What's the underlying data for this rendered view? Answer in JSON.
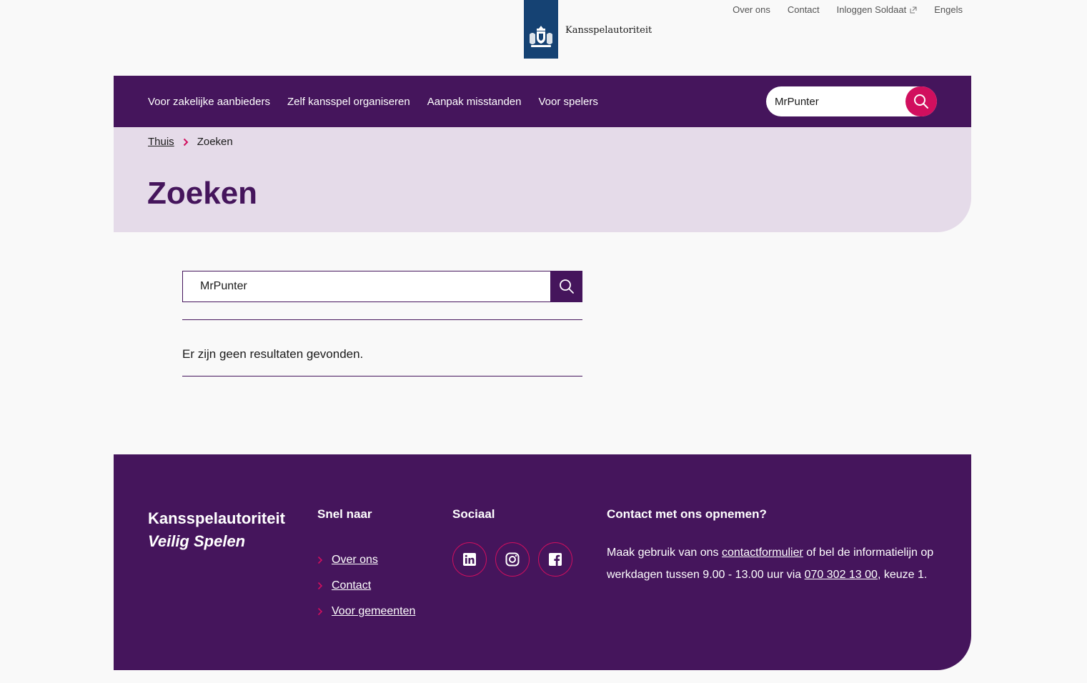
{
  "brand": {
    "name": "Kansspelautoriteit"
  },
  "utility_nav": [
    {
      "label": "Over ons"
    },
    {
      "label": "Contact"
    },
    {
      "label": "Inloggen Soldaat",
      "icon": "external-link-icon"
    },
    {
      "label": "Engels"
    }
  ],
  "main_nav": [
    {
      "label": "Voor zakelijke aanbieders"
    },
    {
      "label": "Zelf kansspel organiseren"
    },
    {
      "label": "Aanpak misstanden"
    },
    {
      "label": "Voor spelers"
    }
  ],
  "nav_search": {
    "value": "MrPunter",
    "icon": "search-icon"
  },
  "breadcrumb": {
    "home": "Thuis",
    "current": "Zoeken"
  },
  "page_title": "Zoeken",
  "search": {
    "value": "MrPunter",
    "icon": "search-icon"
  },
  "results_message": "Er zijn geen resultaten gevonden.",
  "footer": {
    "brand_name": "Kansspelautoriteit",
    "tagline": "Veilig Spelen",
    "quick_links_heading": "Snel naar",
    "quick_links": [
      {
        "label": "Over ons"
      },
      {
        "label": "Contact"
      },
      {
        "label": "Voor gemeenten"
      }
    ],
    "social_heading": "Sociaal",
    "socials": [
      {
        "icon": "linkedin-icon"
      },
      {
        "icon": "instagram-icon"
      },
      {
        "icon": "facebook-icon"
      }
    ],
    "contact_heading": "Contact met ons opnemen?",
    "contact": {
      "t1": "Maak gebruik van ons ",
      "link_form": "contactformulier",
      "t2": " of bel de informatielijn op werkdagen tussen 9.00 - 13.00 uur via ",
      "link_phone": "070 302 13 00",
      "t3": ", keuze 1."
    }
  },
  "colors": {
    "purple": "#45155c",
    "magenta": "#d10f5e",
    "lilac": "#e5dbe9",
    "rijks_blue": "#154273"
  }
}
